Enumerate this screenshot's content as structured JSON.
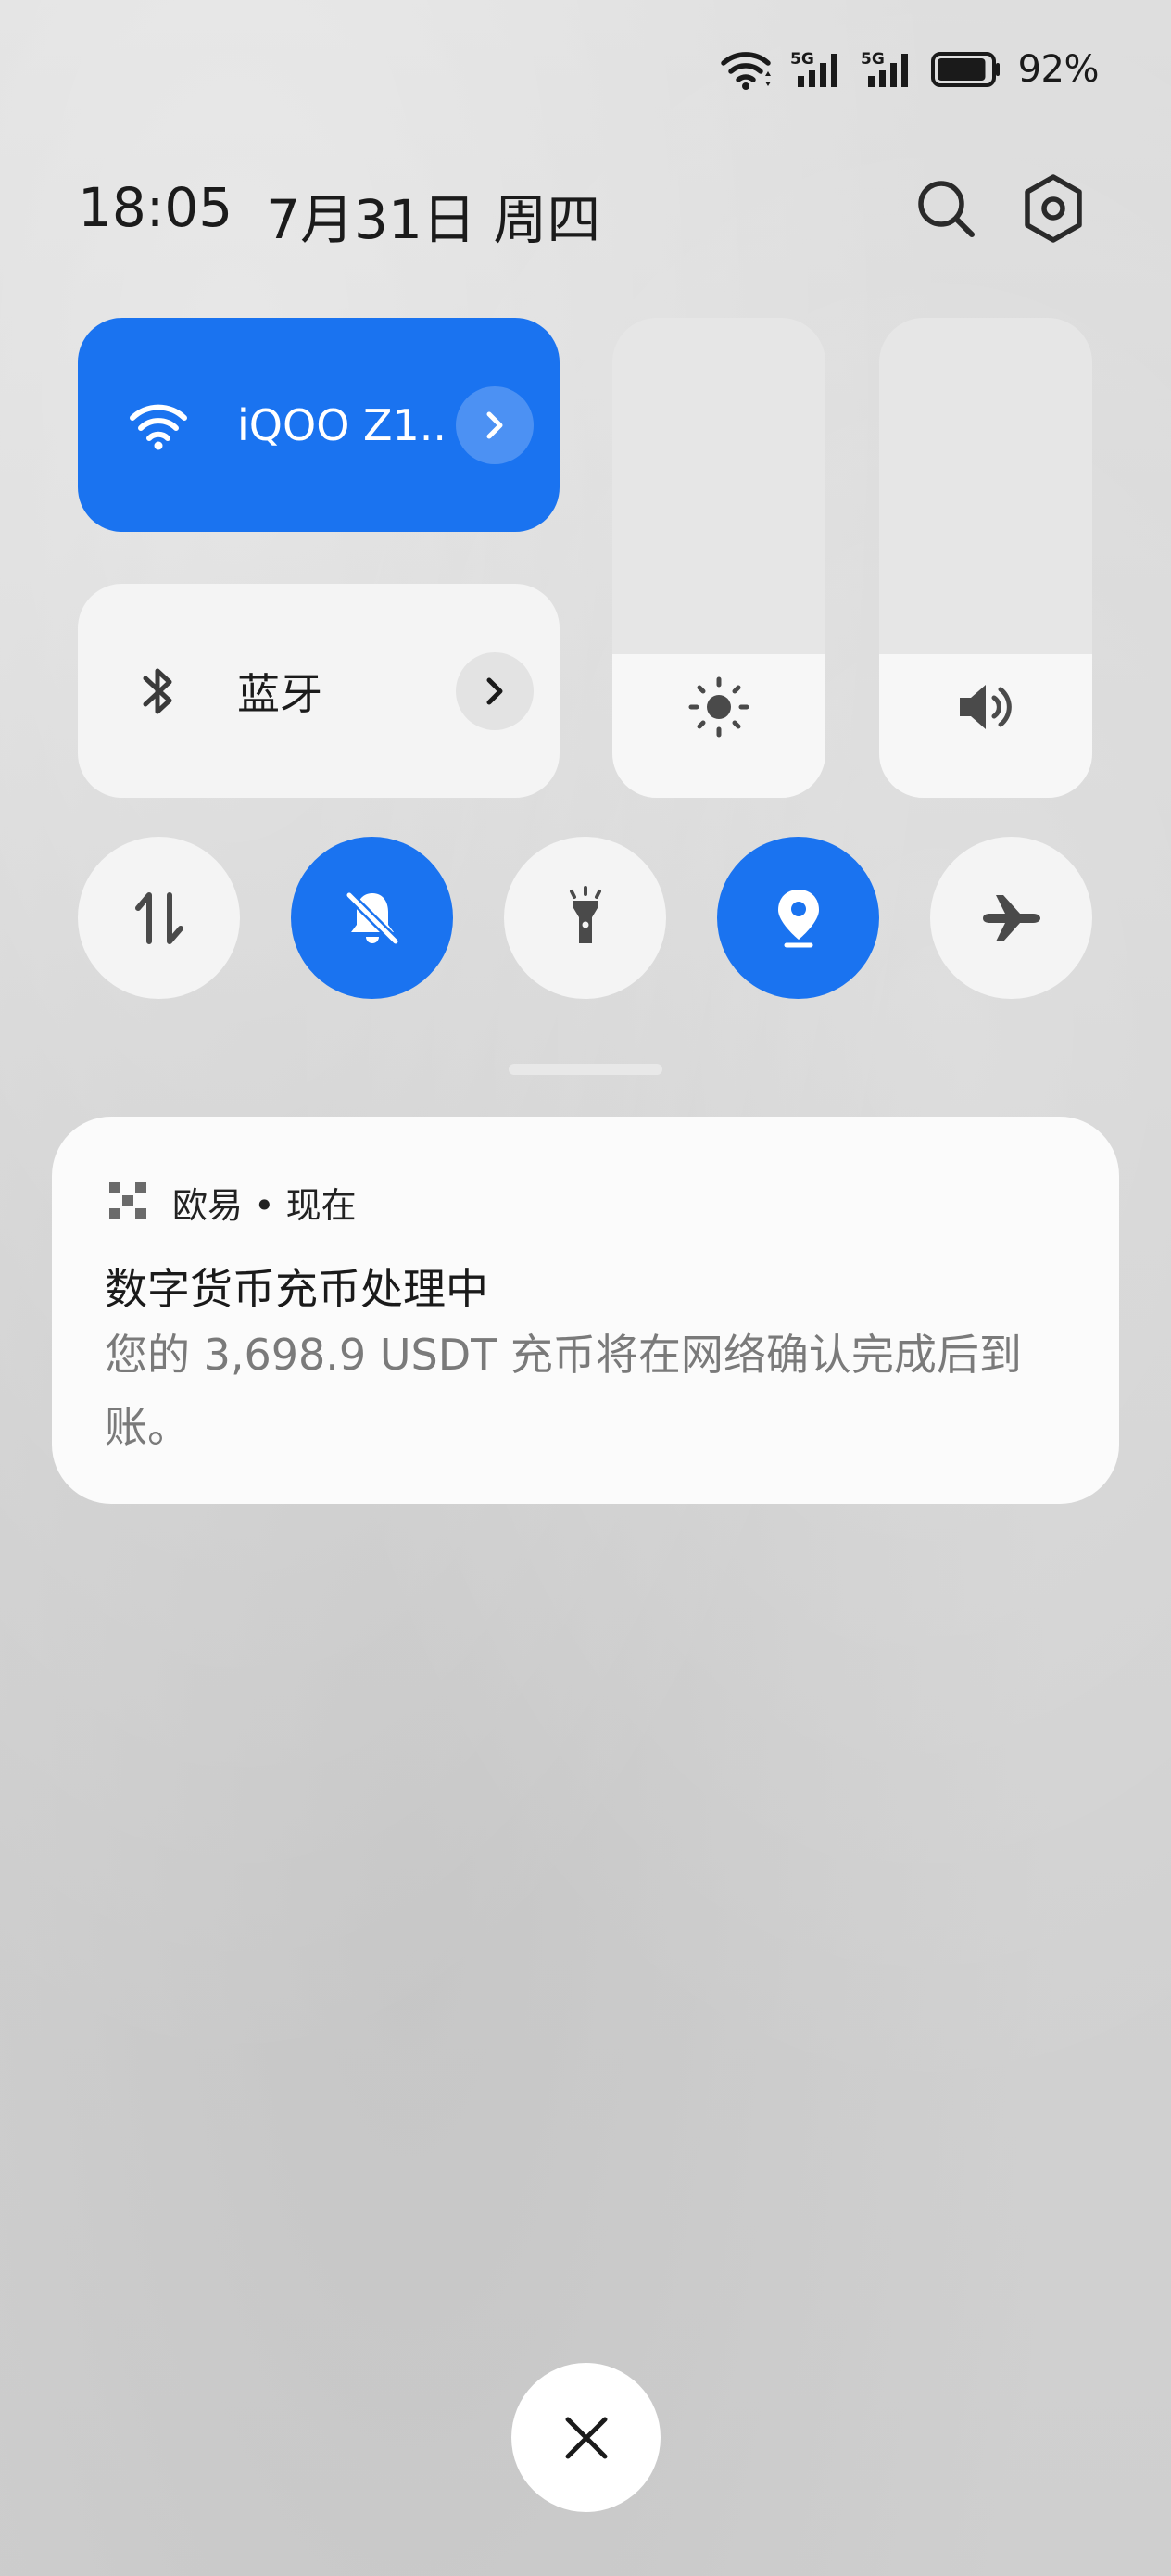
{
  "status_bar": {
    "battery_percent": "92%",
    "battery_level": 0.92,
    "network_1": "5G",
    "network_2": "5G",
    "icons": [
      "wifi-icon",
      "signal-5g-icon",
      "signal-5g-icon",
      "battery-icon"
    ]
  },
  "header": {
    "time": "18:05",
    "date": "7月31日",
    "weekday": "周四",
    "search_icon": "search-icon",
    "settings_icon": "gear-icon"
  },
  "tiles": {
    "wifi": {
      "label": "iQOO Z1..",
      "active": true,
      "icon": "wifi-icon"
    },
    "bluetooth": {
      "label": "蓝牙",
      "active": false,
      "icon": "bluetooth-icon"
    }
  },
  "sliders": {
    "brightness": {
      "level": 0.3,
      "icon": "brightness-icon"
    },
    "volume": {
      "level": 0.3,
      "icon": "volume-icon"
    }
  },
  "toggles": [
    {
      "name": "mobile-data",
      "icon": "data-transfer-icon",
      "active": false
    },
    {
      "name": "silent",
      "icon": "bell-off-icon",
      "active": true
    },
    {
      "name": "flashlight",
      "icon": "flashlight-icon",
      "active": false
    },
    {
      "name": "location",
      "icon": "location-icon",
      "active": true
    },
    {
      "name": "airplane-mode",
      "icon": "airplane-icon",
      "active": false
    }
  ],
  "notification": {
    "app_name": "欧易 • 现在",
    "title": "数字货币充币处理中",
    "body": "您的 3,698.9 USDT 充币将在网络确认完成后到账。"
  },
  "colors": {
    "accent": "#1a73f0",
    "background": "#d6d6d6",
    "card": "#fbfbfb"
  }
}
